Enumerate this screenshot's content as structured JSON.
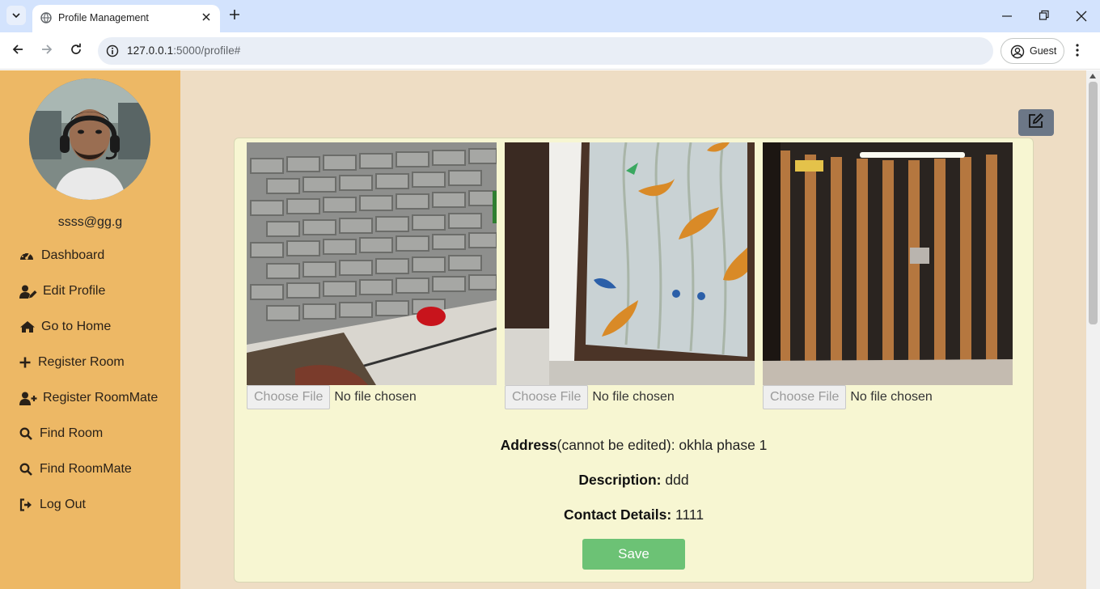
{
  "browser": {
    "tab_title": "Profile Management",
    "url_host": "127.0.0.1",
    "url_path": ":5000/profile#",
    "profile_label": "Guest"
  },
  "sidebar": {
    "email": "ssss@gg.g",
    "items": [
      {
        "label": "Dashboard",
        "icon": "dashboard-gauge-icon"
      },
      {
        "label": "Edit Profile",
        "icon": "user-edit-icon"
      },
      {
        "label": "Go to Home",
        "icon": "home-icon"
      },
      {
        "label": "Register Room",
        "icon": "plus-icon"
      },
      {
        "label": "Register RoomMate",
        "icon": "user-plus-icon"
      },
      {
        "label": "Find Room",
        "icon": "search-icon"
      },
      {
        "label": "Find RoomMate",
        "icon": "search-icon"
      },
      {
        "label": "Log Out",
        "icon": "sign-out-icon"
      }
    ]
  },
  "uploads": [
    {
      "button": "Choose File",
      "status": "No file chosen"
    },
    {
      "button": "Choose File",
      "status": "No file chosen"
    },
    {
      "button": "Choose File",
      "status": "No file chosen"
    }
  ],
  "details": {
    "address_label": "Address",
    "address_note": "(cannot be edited): okhla phase 1",
    "description_label": "Description:",
    "description_value": " ddd",
    "contact_label": "Contact Details:",
    "contact_value": " 1111"
  },
  "save_label": "Save",
  "colors": {
    "sidebar": "#edb865",
    "page_bg": "#eeddc4",
    "card_bg": "#f7f6d2",
    "save": "#6cc275",
    "edit_button": "#6c7787"
  }
}
